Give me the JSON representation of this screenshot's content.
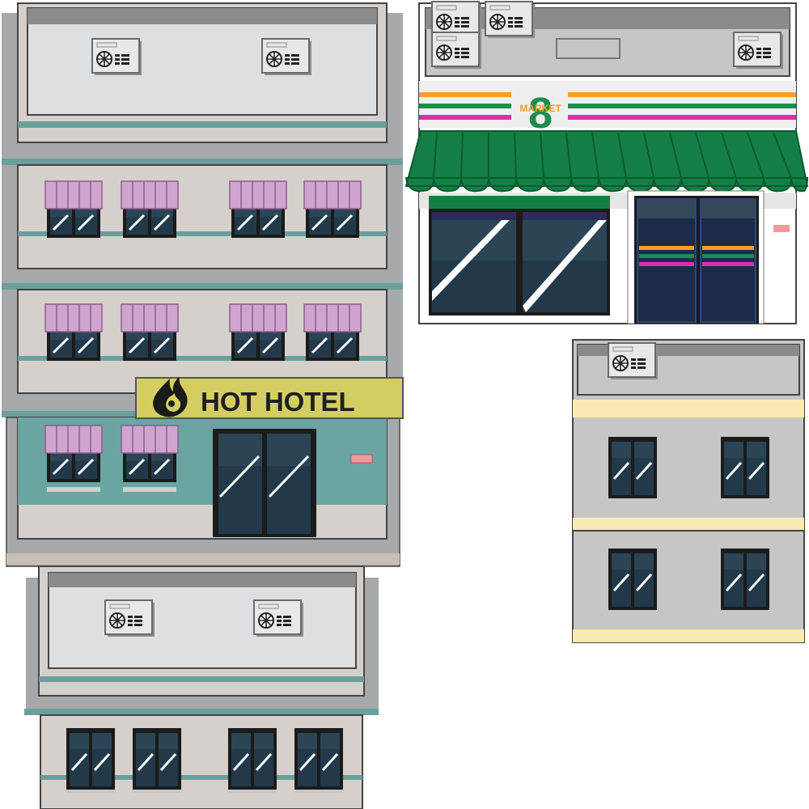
{
  "scene": {
    "type": "game tileset sprites",
    "sprites": [
      "hotel-roof",
      "hotel-building",
      "small-building",
      "convenience-store",
      "apartment-block"
    ]
  },
  "hotel": {
    "sign_text": "HOT HOTEL",
    "sign_color": "#d4ce62",
    "wall_color": "#d5d0cb",
    "trim_color": "#6a9f9c",
    "lobby_color": "#6aa5a2",
    "awning_color": "#cfa5d0"
  },
  "store": {
    "logo_digit": "8",
    "logo_text": "MARKET",
    "awning_color": "#137f46",
    "stripe_colors": [
      "#f0a02b",
      "#1f8c4c",
      "#e02fa5"
    ]
  },
  "apartment": {
    "band_color": "#fbeab4",
    "wall_color": "#c6c6c6"
  },
  "colors": {
    "window_glass": "#1f3340",
    "window_frame": "#1b1b1b",
    "roof_gray": "#dedfe1",
    "ac_unit": "#e8e8e8"
  }
}
